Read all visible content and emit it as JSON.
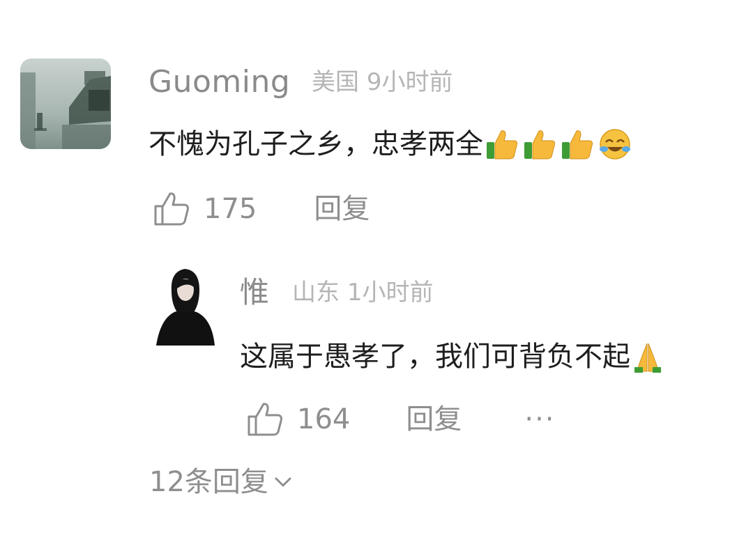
{
  "comment": {
    "username": "Guoming",
    "location": "美国",
    "time": "9小时前",
    "text": "不愧为孔子之乡，忠孝两全",
    "emojis": [
      "thumbs-up",
      "thumbs-up",
      "thumbs-up",
      "crying-laughing"
    ],
    "likes": "175",
    "reply_label": "回复"
  },
  "reply": {
    "username": "惟",
    "location": "山东",
    "time": "1小时前",
    "text": "这属于愚孝了，我们可背负不起",
    "emojis": [
      "folded-hands"
    ],
    "likes": "164",
    "reply_label": "回复",
    "more_label": "···"
  },
  "view_replies_label": "12条回复",
  "colors": {
    "text_primary": "#1e1e1e",
    "text_secondary": "#8a8a8a",
    "text_meta": "#b5b5b5",
    "emoji_yellow": "#f6b93b",
    "emoji_green": "#3e9c35"
  }
}
